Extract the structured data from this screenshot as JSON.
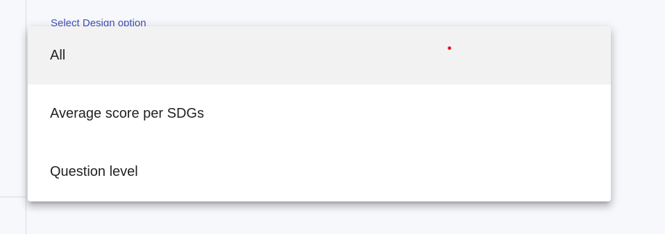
{
  "field": {
    "label": "Select Design option"
  },
  "menu": {
    "items": [
      {
        "label": "All",
        "selected": true
      },
      {
        "label": "Average score per SDGs",
        "selected": false
      },
      {
        "label": "Question level",
        "selected": false
      }
    ]
  },
  "colors": {
    "label_accent": "#3f51b5",
    "selected_background": "#f2f2f2",
    "indicator": "#e01b1b"
  }
}
